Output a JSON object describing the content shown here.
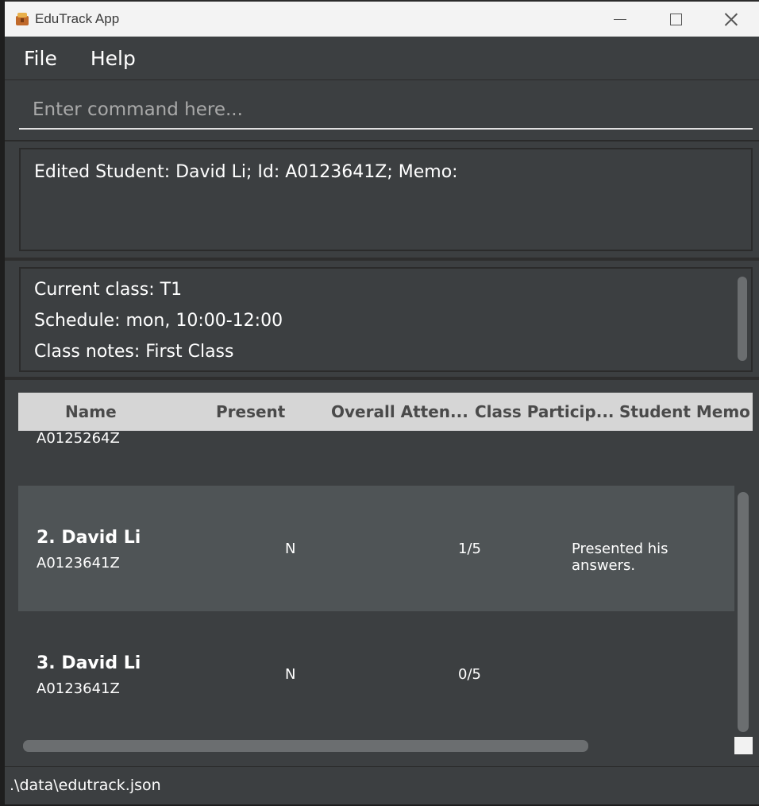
{
  "window": {
    "title": "EduTrack App"
  },
  "menu": {
    "file": "File",
    "help": "Help"
  },
  "command": {
    "placeholder": "Enter command here..."
  },
  "result": {
    "text": "Edited Student: David Li; Id: A0123641Z; Memo:"
  },
  "class_info": {
    "current_class": "Current class: T1",
    "schedule": "Schedule: mon, 10:00-12:00",
    "notes": "Class notes: First Class"
  },
  "table": {
    "headers": [
      "Name",
      "Present",
      "Overall Atten...",
      "Class Particip...",
      "Student Memo"
    ],
    "rows": [
      {
        "name": "",
        "id": "A0125264Z",
        "present": "",
        "participation": "",
        "memo": ""
      },
      {
        "name": "2.  David Li",
        "id": "A0123641Z",
        "present": "N",
        "participation": "1/5",
        "memo": "Presented his answers."
      },
      {
        "name": "3.  David Li",
        "id": "A0123641Z",
        "present": "N",
        "participation": "0/5",
        "memo": ""
      }
    ]
  },
  "status": {
    "path": ".\\data\\edutrack.json"
  },
  "colors": {
    "background": "#3c3f41",
    "selected_row": "#4f5456",
    "header": "#d6d6d6"
  }
}
